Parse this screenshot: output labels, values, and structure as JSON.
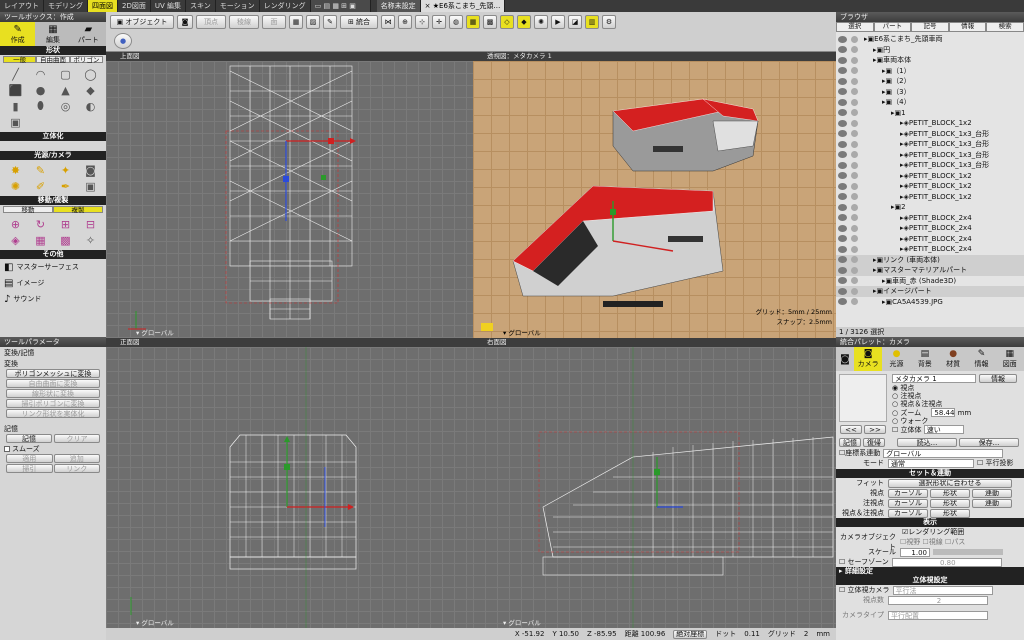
{
  "topbar": {
    "workspaces": [
      "レイアウト",
      "モデリング",
      "四面図",
      "2D図面",
      "UV 編集",
      "スキン",
      "モーション",
      "レンダリング"
    ],
    "active_workspace": "四面図",
    "docs": [
      "名称未設定",
      "× ★E6系こまち_先頭…"
    ]
  },
  "toolbox": {
    "title": "ツールボックス：作成",
    "modes": [
      "作成",
      "編集",
      "パート"
    ],
    "sections": {
      "shape": "形状",
      "solid": "立体化",
      "light": "光源/カメラ",
      "move": "移動/複製",
      "other": "その他"
    },
    "shape_tabs": [
      "一般",
      "自由曲面",
      "ポリゴン"
    ],
    "move_tabs": [
      "移動",
      "複製"
    ],
    "other_items": [
      "マスターサーフェス",
      "イメージ",
      "サウンド"
    ]
  },
  "toolparam": {
    "title": "ツールパラメータ",
    "header": "変換/記憶",
    "convert_label": "変換",
    "convert_buttons": [
      "ポリゴンメッシュに変換",
      "自由曲面に変換",
      "線形状に変換",
      "掃引ポリゴンに変換",
      "リンク形状を実体化"
    ],
    "memory_label": "記憶",
    "memory_buttons": [
      "記憶",
      "クリア"
    ],
    "smooth_label": "スムーズ",
    "smooth_buttons": [
      "適用",
      "追加",
      "掃引",
      "リンク"
    ]
  },
  "toolbar": {
    "object_label": "オブジェクト",
    "vertex": "頂点",
    "edge": "稜線",
    "face": "面",
    "merge": "統合"
  },
  "viewports": {
    "top": {
      "title": "上面図",
      "foot": "▾ グローバル"
    },
    "persp": {
      "title": "透視図：メタカメラ 1",
      "foot": "▾ グローバル",
      "grid": "グリッド：5mm / 25mm",
      "snap": "スナップ：2.5mm"
    },
    "front": {
      "title": "正面図",
      "foot": "▾ グローバル"
    },
    "right": {
      "title": "右面図",
      "foot": "▾ グローバル"
    }
  },
  "statusbar": {
    "x": "X   -51.92",
    "y": "Y   10.50",
    "z": "Z   -85.95",
    "dist": "距離   100.96",
    "coord": "絶対座標",
    "dot": "ドット",
    "dot_val": "0.11",
    "grid": "グリッド",
    "grid_val": "2",
    "unit": "mm"
  },
  "browser": {
    "title": "ブラウザ",
    "tabs": [
      "選択",
      "パート",
      "記号",
      "情報",
      "検索"
    ],
    "items": [
      {
        "label": "E6系こまち_先頭車両",
        "indent": 0
      },
      {
        "label": "円",
        "indent": 1
      },
      {
        "label": "車両本体",
        "indent": 1
      },
      {
        "label": "（1）",
        "indent": 2
      },
      {
        "label": "（2）",
        "indent": 2
      },
      {
        "label": "（3）",
        "indent": 2
      },
      {
        "label": "（4）",
        "indent": 2
      },
      {
        "label": "1",
        "indent": 3
      },
      {
        "label": "PETIT_BLOCK_1x2",
        "indent": 4
      },
      {
        "label": "PETIT_BLOCK_1x3_台形",
        "indent": 4
      },
      {
        "label": "PETIT_BLOCK_1x3_台形",
        "indent": 4
      },
      {
        "label": "PETIT_BLOCK_1x3_台形",
        "indent": 4
      },
      {
        "label": "PETIT_BLOCK_1x3_台形",
        "indent": 4
      },
      {
        "label": "PETIT_BLOCK_1x2",
        "indent": 4
      },
      {
        "label": "PETIT_BLOCK_1x2",
        "indent": 4
      },
      {
        "label": "PETIT_BLOCK_1x2",
        "indent": 4
      },
      {
        "label": "2",
        "indent": 3
      },
      {
        "label": "PETIT_BLOCK_2x4",
        "indent": 4
      },
      {
        "label": "PETIT_BLOCK_2x4",
        "indent": 4
      },
      {
        "label": "PETIT_BLOCK_2x4",
        "indent": 4
      },
      {
        "label": "PETIT_BLOCK_2x4",
        "indent": 4
      },
      {
        "label": "リンク (車両本体)",
        "indent": 1
      },
      {
        "label": "マスターマテリアルパート",
        "indent": 1
      },
      {
        "label": "車両_赤 (Shade3D)",
        "indent": 2
      },
      {
        "label": "イメージパート",
        "indent": 1
      },
      {
        "label": "CA5A4539.JPG",
        "indent": 2
      }
    ],
    "footer": "1 / 3126 選択"
  },
  "palette": {
    "title": "統合パレット：カメラ",
    "tabs": [
      "カメラ",
      "光源",
      "背景",
      "材質",
      "情報",
      "図面"
    ],
    "camera_name": "メタカメラ 1",
    "info_btn": "情報",
    "radios": [
      "視点",
      "注視点",
      "視点＆注視点",
      "ズーム",
      "ウォーク"
    ],
    "zoom_val": "58.44",
    "zoom_unit": "mm",
    "stereo": "立体体",
    "stereo_opt": "速い",
    "nav": [
      "<<",
      ">>"
    ],
    "mem_buttons": [
      "記憶",
      "復帰",
      "読込...",
      "保存..."
    ],
    "link_label": "座標系連動",
    "link_val": "グローバル",
    "mode_label": "モード",
    "mode_val": "通常",
    "parallel": "平行投影",
    "set_section": "セット＆連動",
    "fit_label": "フィット",
    "fit_btn": "選択形状に合わせる",
    "rows": [
      {
        "label": "視点",
        "b1": "カーソル",
        "b2": "形状",
        "b3": "連動"
      },
      {
        "label": "注視点",
        "b1": "カーソル",
        "b2": "形状",
        "b3": "連動"
      },
      {
        "label": "視点＆注視点",
        "b1": "カーソル",
        "b2": "形状",
        "b3": ""
      }
    ],
    "display_section": "表示",
    "render_range": "レンダリング範囲",
    "cam_obj": "カメラオブジェクト",
    "cam_opts": [
      "視野",
      "視線",
      "パス"
    ],
    "scale_label": "スケール",
    "scale_val": "1.00",
    "safe_zone": "セーフゾーン",
    "safe_val": "0.80",
    "detail_section": "詳細設定",
    "stereo_section": "立体視設定",
    "stereo_cam": "立体視カメラ",
    "stereo_cam_val": "平行法",
    "eye_dist": "視点数",
    "eye_val": "2",
    "cam_type": "カメラタイプ",
    "cam_type_val": "平行配置"
  },
  "colors": {
    "accent": "#e8e020",
    "train_red": "#d42020",
    "floor": "#c9a478"
  }
}
